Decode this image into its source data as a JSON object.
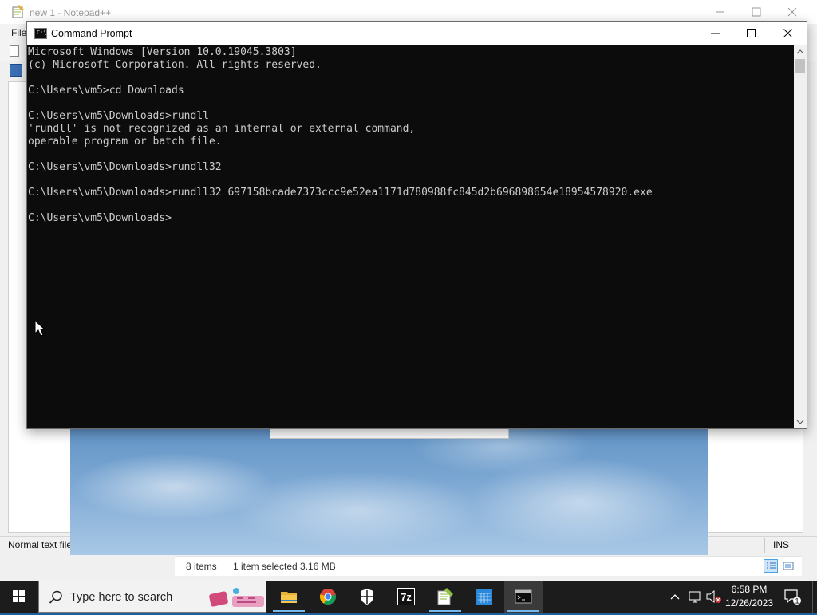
{
  "notepad": {
    "title": "new 1 - Notepad++",
    "menu_file": "File",
    "status_left": "Normal text file",
    "status_ins": "INS"
  },
  "explorer": {
    "item_count": "8 items",
    "selection": "1 item selected  3.16 MB"
  },
  "cmd": {
    "title": "Command Prompt",
    "lines": [
      "Microsoft Windows [Version 10.0.19045.3803]",
      "(c) Microsoft Corporation. All rights reserved.",
      "",
      "C:\\Users\\vm5>cd Downloads",
      "",
      "C:\\Users\\vm5\\Downloads>rundll",
      "'rundll' is not recognized as an internal or external command,",
      "operable program or batch file.",
      "",
      "C:\\Users\\vm5\\Downloads>rundll32",
      "",
      "C:\\Users\\vm5\\Downloads>rundll32 697158bcade7373ccc9e52ea1171d780988fc845d2b696898654e18954578920.exe",
      "",
      "C:\\Users\\vm5\\Downloads>"
    ],
    "icon_glyph": "C:\\_"
  },
  "taskbar": {
    "search_placeholder": "Type here to search",
    "apps": [
      {
        "name": "file-explorer",
        "icon": "folder-icon"
      },
      {
        "name": "chrome",
        "icon": "chrome-icon"
      },
      {
        "name": "windows-security",
        "icon": "shield-icon"
      },
      {
        "name": "7zip",
        "icon": "7zip-icon",
        "label": "7z"
      },
      {
        "name": "notepad-plus-plus",
        "icon": "notepadpp-icon"
      },
      {
        "name": "calendar-app",
        "icon": "calendar-icon"
      },
      {
        "name": "command-prompt",
        "icon": "cmd-icon",
        "active": true
      }
    ],
    "time": "6:58 PM",
    "date": "12/26/2023",
    "notification_count": "1"
  },
  "colors": {
    "console_bg": "#0c0c0c",
    "console_fg": "#cccccc",
    "taskbar_bg": "#1c1c1c",
    "active_accent": "#76b9ed"
  }
}
